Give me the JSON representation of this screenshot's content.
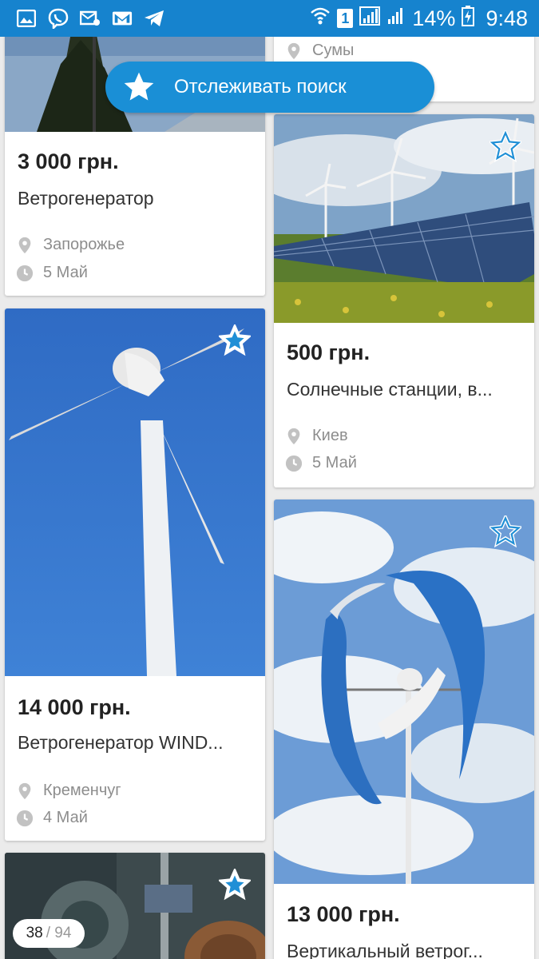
{
  "status_bar": {
    "battery": "14%",
    "time": "9:48",
    "sim": "1",
    "left_icons": [
      "gallery-icon",
      "viber-icon",
      "mail-badge-icon",
      "gmail-icon",
      "telegram-icon"
    ]
  },
  "track_button": {
    "label": "Отслеживать поиск",
    "icon": "star-icon"
  },
  "listings": [
    {
      "price": "3 000 грн.",
      "title": "Ветрогенератор",
      "city": "Запорожье",
      "date": "5 Май"
    },
    {
      "price": "",
      "title": "",
      "city": "Сумы",
      "date": ""
    },
    {
      "price": "500 грн.",
      "title": "Солнечные станции, в...",
      "city": "Киев",
      "date": "5 Май"
    },
    {
      "price": "14 000 грн.",
      "title": "Ветрогенератор WIND...",
      "city": "Кременчуг",
      "date": "4 Май"
    },
    {
      "price": "13 000 грн.",
      "title": "Вертикальный ветрог...",
      "city": "",
      "date": ""
    }
  ],
  "photo_counter": {
    "current": "38",
    "total": "/ 94"
  },
  "colors": {
    "accent": "#1683ce",
    "button": "#1a8fd6",
    "star": "#1f8fd6"
  }
}
